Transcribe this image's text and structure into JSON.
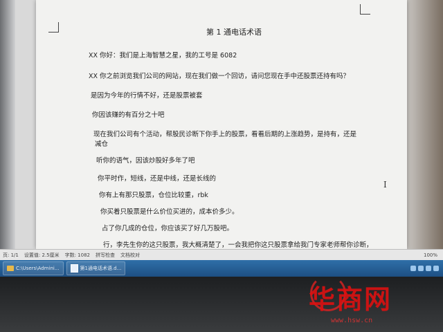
{
  "document": {
    "title": "第 1 通电话术语",
    "lines": [
      "XX 你好：我们是上海智慧之星，我的工号是 6082",
      "XX 你之前浏览我们公司的网站，现在我们做一个回访，请问您现在手中还股票还持有吗？",
      "是因为今年的行情不好，还是股票被套",
      "你因该赚的有百分之十吧",
      "现在我们公司有个活动，帮股民诊断下你手上的股票，看看后期的上涨趋势，是持有，还是",
      "减仓",
      "听你的语气，因该炒股好多年了吧",
      "你平时作，短线，还是中线，还是长线的",
      "你有上有那只股票，仓位比较重，rbk",
      "你买着只股票是什么价位买进的，成本价多少。",
      "占了你几成的仓位，你应该买了好几万股吧。",
      "行，李先生你的这只股票，我大概清楚了，一会我把你这只股票拿给我门专家老师帮你诊断，"
    ]
  },
  "statusbar": {
    "page": "页: 1/1",
    "settings": "设置值: 2.5厘米",
    "wordcount": "字数: 1082",
    "spellcheck": "拼写检查",
    "compare": "文档校对",
    "zoom": "100%"
  },
  "taskbar": {
    "explorer_label": "C:\\Users\\Admini...",
    "doc_label": "第1通电话术语.d..."
  },
  "watermark": {
    "logo_text": "华商网",
    "url": "www.hsw.cn"
  }
}
